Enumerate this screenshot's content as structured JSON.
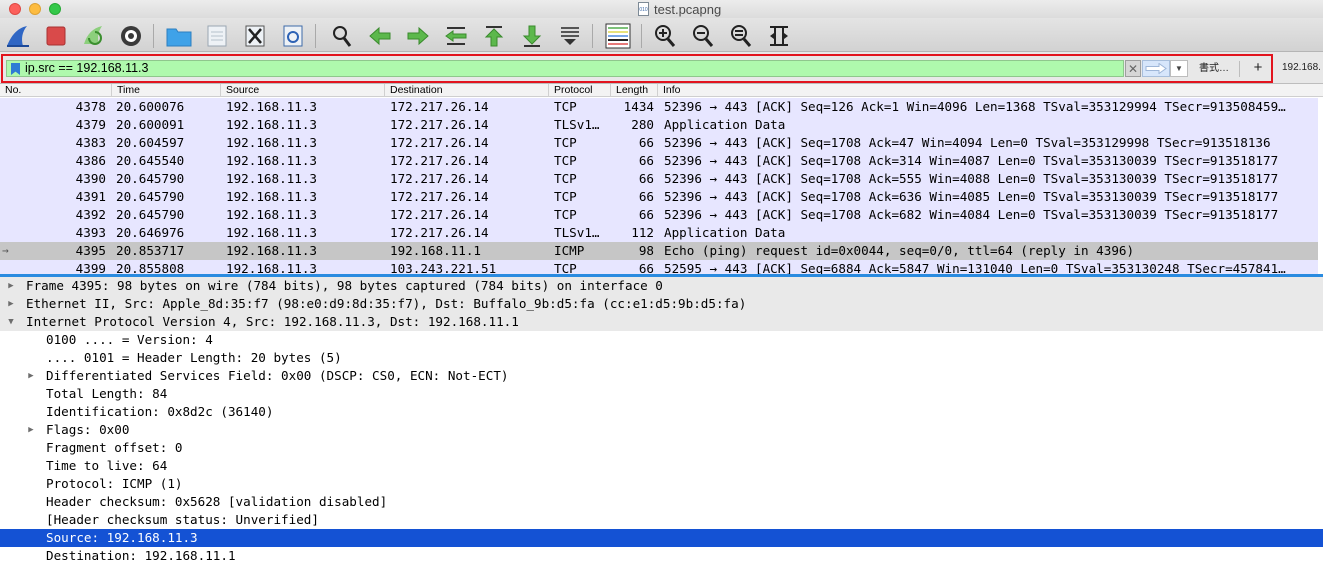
{
  "window": {
    "title": "test.pcapng",
    "doc_icon_text": "010"
  },
  "toolbar": {
    "buttons": [
      "shark-fin-start-icon",
      "stop-capture-icon",
      "restart-capture-icon",
      "capture-options-icon",
      "open-file-icon",
      "save-file-icon",
      "close-file-icon",
      "reload-file-icon",
      "find-packet-icon",
      "go-back-icon",
      "go-forward-icon",
      "go-to-packet-icon",
      "go-first-packet-icon",
      "go-last-packet-icon",
      "auto-scroll-icon",
      "colorize-icon",
      "zoom-in-icon",
      "zoom-out-icon",
      "zoom-normal-icon",
      "resize-columns-icon"
    ]
  },
  "filter": {
    "value": "ip.src == 192.168.11.3",
    "expression_label": "書式…",
    "add_label": "+",
    "side_label": "192.168."
  },
  "packet_list": {
    "columns": [
      "No.",
      "Time",
      "Source",
      "Destination",
      "Protocol",
      "Length",
      "Info"
    ],
    "rows": [
      {
        "no": "4378",
        "time": "20.600076",
        "src": "192.168.11.3",
        "dst": "172.217.26.14",
        "proto": "TCP",
        "len": "1434",
        "info": "52396 → 443 [ACK] Seq=126 Ack=1 Win=4096 Len=1368 TSval=353129994 TSecr=913508459…"
      },
      {
        "no": "4379",
        "time": "20.600091",
        "src": "192.168.11.3",
        "dst": "172.217.26.14",
        "proto": "TLSv1…",
        "len": "280",
        "info": "Application Data"
      },
      {
        "no": "4383",
        "time": "20.604597",
        "src": "192.168.11.3",
        "dst": "172.217.26.14",
        "proto": "TCP",
        "len": "66",
        "info": "52396 → 443 [ACK] Seq=1708 Ack=47 Win=4094 Len=0 TSval=353129998 TSecr=913518136"
      },
      {
        "no": "4386",
        "time": "20.645540",
        "src": "192.168.11.3",
        "dst": "172.217.26.14",
        "proto": "TCP",
        "len": "66",
        "info": "52396 → 443 [ACK] Seq=1708 Ack=314 Win=4087 Len=0 TSval=353130039 TSecr=913518177"
      },
      {
        "no": "4390",
        "time": "20.645790",
        "src": "192.168.11.3",
        "dst": "172.217.26.14",
        "proto": "TCP",
        "len": "66",
        "info": "52396 → 443 [ACK] Seq=1708 Ack=555 Win=4088 Len=0 TSval=353130039 TSecr=913518177"
      },
      {
        "no": "4391",
        "time": "20.645790",
        "src": "192.168.11.3",
        "dst": "172.217.26.14",
        "proto": "TCP",
        "len": "66",
        "info": "52396 → 443 [ACK] Seq=1708 Ack=636 Win=4085 Len=0 TSval=353130039 TSecr=913518177"
      },
      {
        "no": "4392",
        "time": "20.645790",
        "src": "192.168.11.3",
        "dst": "172.217.26.14",
        "proto": "TCP",
        "len": "66",
        "info": "52396 → 443 [ACK] Seq=1708 Ack=682 Win=4084 Len=0 TSval=353130039 TSecr=913518177"
      },
      {
        "no": "4393",
        "time": "20.646976",
        "src": "192.168.11.3",
        "dst": "172.217.26.14",
        "proto": "TLSv1…",
        "len": "112",
        "info": "Application Data"
      },
      {
        "no": "4395",
        "time": "20.853717",
        "src": "192.168.11.3",
        "dst": "192.168.11.1",
        "proto": "ICMP",
        "len": "98",
        "info": "Echo (ping) request  id=0x0044, seq=0/0, ttl=64 (reply in 4396)",
        "selected": true,
        "related": "→"
      },
      {
        "no": "4399",
        "time": "20.855808",
        "src": "192.168.11.3",
        "dst": "103.243.221.51",
        "proto": "TCP",
        "len": "66",
        "info": "52595 → 443 [ACK] Seq=6884 Ack=5847 Win=131040 Len=0 TSval=353130248 TSecr=457841…"
      }
    ]
  },
  "details": {
    "rows": [
      {
        "text": "Frame 4395: 98 bytes on wire (784 bits), 98 bytes captured (784 bits) on interface 0",
        "level": 0,
        "tri": "▶",
        "hdr": true
      },
      {
        "text": "Ethernet II, Src: Apple_8d:35:f7 (98:e0:d9:8d:35:f7), Dst: Buffalo_9b:d5:fa (cc:e1:d5:9b:d5:fa)",
        "level": 0,
        "tri": "▶",
        "hdr": true
      },
      {
        "text": "Internet Protocol Version 4, Src: 192.168.11.3, Dst: 192.168.11.1",
        "level": 0,
        "tri": "▼",
        "hdr": true
      },
      {
        "text": "0100 .... = Version: 4",
        "level": 1,
        "tri": ""
      },
      {
        "text": ".... 0101 = Header Length: 20 bytes (5)",
        "level": 1,
        "tri": ""
      },
      {
        "text": "Differentiated Services Field: 0x00 (DSCP: CS0, ECN: Not-ECT)",
        "level": 1,
        "tri": "▶"
      },
      {
        "text": "Total Length: 84",
        "level": 1,
        "tri": ""
      },
      {
        "text": "Identification: 0x8d2c (36140)",
        "level": 1,
        "tri": ""
      },
      {
        "text": "Flags: 0x00",
        "level": 1,
        "tri": "▶"
      },
      {
        "text": "Fragment offset: 0",
        "level": 1,
        "tri": ""
      },
      {
        "text": "Time to live: 64",
        "level": 1,
        "tri": ""
      },
      {
        "text": "Protocol: ICMP (1)",
        "level": 1,
        "tri": ""
      },
      {
        "text": "Header checksum: 0x5628 [validation disabled]",
        "level": 1,
        "tri": ""
      },
      {
        "text": "[Header checksum status: Unverified]",
        "level": 1,
        "tri": ""
      },
      {
        "text": "Source: 192.168.11.3",
        "level": 1,
        "tri": "",
        "selected": true
      },
      {
        "text": "Destination: 192.168.11.1",
        "level": 1,
        "tri": ""
      }
    ]
  },
  "colors": {
    "row_bg": "#e7e6ff",
    "selected_row_bg": "#c6c6c6",
    "filter_bg": "#aff9ad",
    "filter_frame": "#e2141e",
    "detail_selected": "#1452d4"
  }
}
